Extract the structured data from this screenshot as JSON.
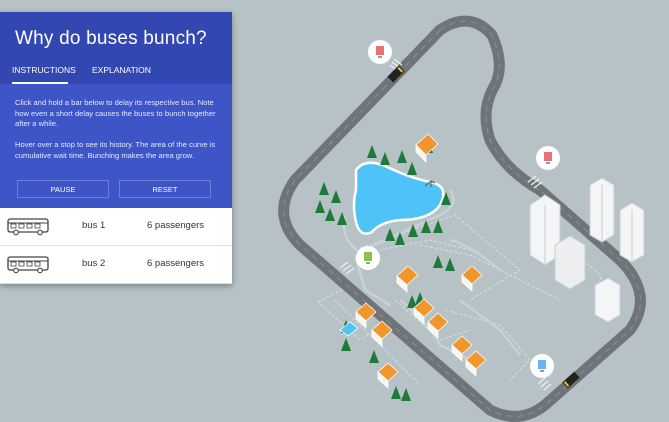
{
  "panel": {
    "title": "Why do buses bunch?",
    "tabs": [
      {
        "label": "INSTRUCTIONS",
        "active": true
      },
      {
        "label": "EXPLANATION",
        "active": false
      }
    ],
    "paragraph1": "Click and hold a bar below to delay its respective bus. Note how even a short delay causes the buses to bunch together after a while.",
    "paragraph2": "Hover over a stop to see its history. The area of the curve is cumulative wait time. Bunching makes the area grow.",
    "pause_label": "PAUSE",
    "reset_label": "RESET",
    "buses": [
      {
        "name": "bus 1",
        "passengers": "6 passengers"
      },
      {
        "name": "bus 2",
        "passengers": "6 passengers"
      }
    ]
  },
  "colors": {
    "header": "#3347b3",
    "body": "#3d55c6",
    "background": "#b6c2c6",
    "road": "#6f7478",
    "water": "#4fc3f7",
    "tree": "#1f7a3a",
    "roof": "#f0962d",
    "stop_icon_red": "#e57373",
    "stop_icon_green": "#8bc34a",
    "stop_icon_blue": "#64b5f6"
  },
  "icons": [
    "bus-icon",
    "bus-stop-icon",
    "bus-vehicle-icon",
    "tree-icon",
    "house-icon",
    "office-building-icon",
    "pond-icon",
    "heron-icon"
  ]
}
